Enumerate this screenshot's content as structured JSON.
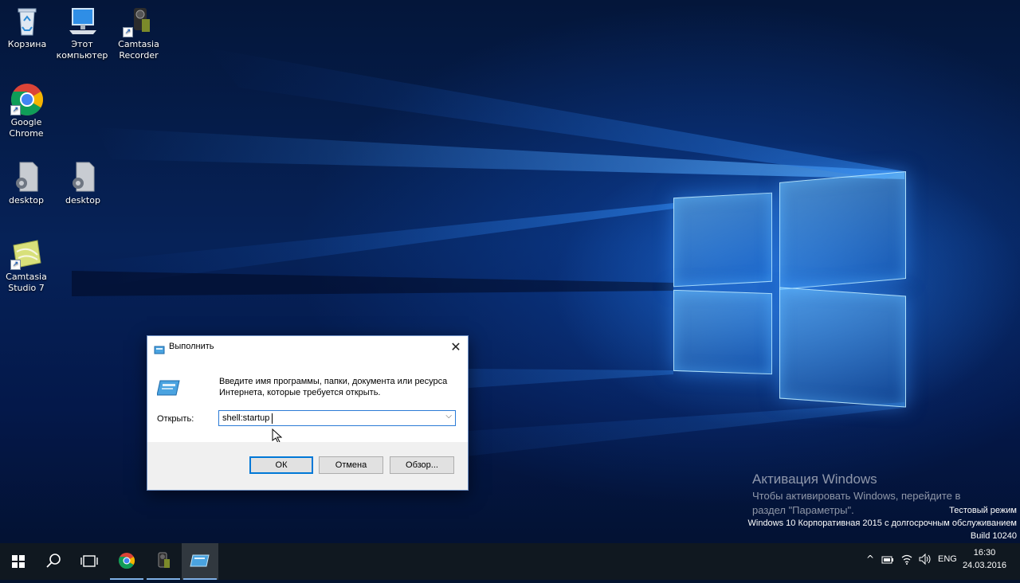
{
  "desktop": {
    "icons": [
      {
        "label_line1": "Корзина",
        "label_line2": "",
        "icon": "recycle-bin-icon"
      },
      {
        "label_line1": "Этот",
        "label_line2": "компьютер",
        "icon": "this-pc-icon"
      },
      {
        "label_line1": "Camtasia",
        "label_line2": "Recorder",
        "icon": "camtasia-recorder-icon"
      },
      {
        "label_line1": "Google",
        "label_line2": "Chrome",
        "icon": "chrome-icon"
      },
      {
        "label_line1": "desktop",
        "label_line2": "",
        "icon": "settings-file-icon"
      },
      {
        "label_line1": "desktop",
        "label_line2": "",
        "icon": "settings-file-icon"
      },
      {
        "label_line1": "Camtasia",
        "label_line2": "Studio 7",
        "icon": "camtasia-studio-icon"
      }
    ],
    "shortcut_arrow": "↗"
  },
  "run_dialog": {
    "title": "Выполнить",
    "close_glyph": "✕",
    "description": "Введите имя программы, папки, документа или ресурса Интернета, которые требуется открыть.",
    "open_label": "Открыть:",
    "open_value": "shell:startup",
    "dropdown_glyph": "⌵",
    "buttons": {
      "ok": "ОК",
      "cancel": "Отмена",
      "browse": "Обзор..."
    }
  },
  "watermark": {
    "title": "Активация Windows",
    "line1": "Чтобы активировать Windows, перейдите в",
    "line2": "раздел \"Параметры\"."
  },
  "system_info": {
    "mode": "Тестовый режим",
    "edition": "Windows 10 Корпоративная 2015 с долгосрочным обслуживанием",
    "build": "Build 10240"
  },
  "taskbar": {
    "tray_chevron": "^",
    "language": "ENG",
    "time": "16:30",
    "date": "24.03.2016"
  },
  "colors": {
    "accent": "#0078d7",
    "taskbar": "#101820"
  }
}
